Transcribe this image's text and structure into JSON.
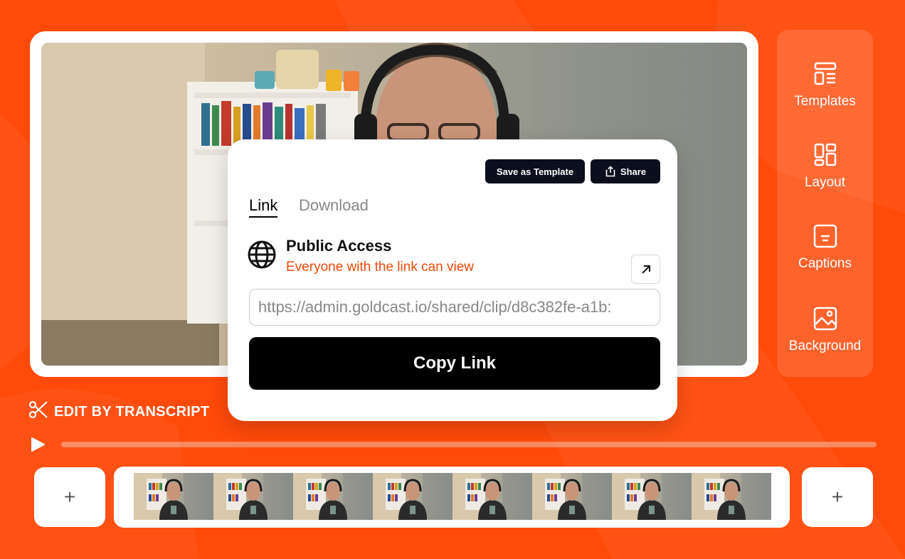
{
  "colors": {
    "brand_orange": "#ff4a0a",
    "accent_text": "#ec4a0a",
    "dark_button": "#0b0e1c"
  },
  "side_panel": {
    "items": [
      {
        "label": "Templates",
        "icon": "templates-icon"
      },
      {
        "label": "Layout",
        "icon": "layout-icon"
      },
      {
        "label": "Captions",
        "icon": "captions-icon"
      },
      {
        "label": "Background",
        "icon": "image-icon"
      }
    ]
  },
  "share_modal": {
    "save_template_label": "Save as Template",
    "share_label": "Share",
    "tabs": [
      {
        "label": "Link",
        "active": true
      },
      {
        "label": "Download",
        "active": false
      }
    ],
    "access_title": "Public Access",
    "access_subtitle": "Everyone with the link can view",
    "url_value": "https://admin.goldcast.io/shared/clip/d8c382fe-a1b:",
    "copy_label": "Copy Link"
  },
  "editor": {
    "edit_transcript_label": "EDIT BY TRANSCRIPT",
    "add_label": "+",
    "filmstrip_frame_count": 8
  }
}
